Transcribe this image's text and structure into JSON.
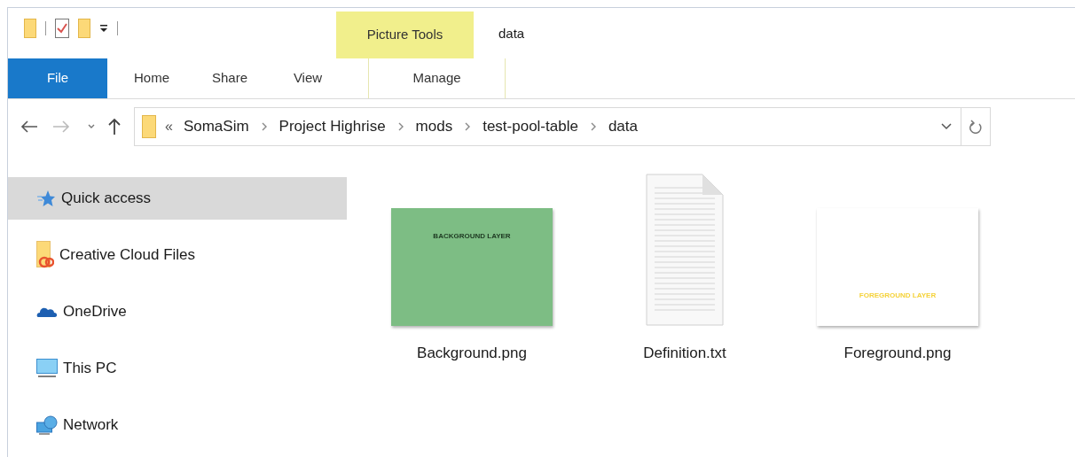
{
  "window": {
    "title": "data"
  },
  "context_tab_group": "Picture Tools",
  "ribbon_tabs": [
    {
      "label": "File",
      "kind": "file",
      "selected": false
    },
    {
      "label": "Home",
      "kind": "tab",
      "selected": false
    },
    {
      "label": "Share",
      "kind": "tab",
      "selected": false
    },
    {
      "label": "View",
      "kind": "tab",
      "selected": false
    },
    {
      "label": "Manage",
      "kind": "context",
      "selected": false
    }
  ],
  "address_bar": {
    "overflow": "«",
    "crumbs": [
      "SomaSim",
      "Project Highrise",
      "mods",
      "test-pool-table",
      "data"
    ]
  },
  "sidebar": {
    "items": [
      {
        "label": "Quick access",
        "kind": "star",
        "selected": true
      },
      {
        "label": "Creative Cloud Files",
        "kind": "cloudfolder",
        "selected": false
      },
      {
        "label": "OneDrive",
        "kind": "onedrive",
        "selected": false
      },
      {
        "label": "This PC",
        "kind": "pc",
        "selected": false
      },
      {
        "label": "Network",
        "kind": "network",
        "selected": false
      }
    ]
  },
  "files": [
    {
      "name": "Background.png",
      "kind": "greenimage",
      "thumbnail_text": "BACKGROUND LAYER"
    },
    {
      "name": "Definition.txt",
      "kind": "text"
    },
    {
      "name": "Foreground.png",
      "kind": "whiteimage",
      "thumbnail_text": "FOREGROUND LAYER"
    }
  ]
}
